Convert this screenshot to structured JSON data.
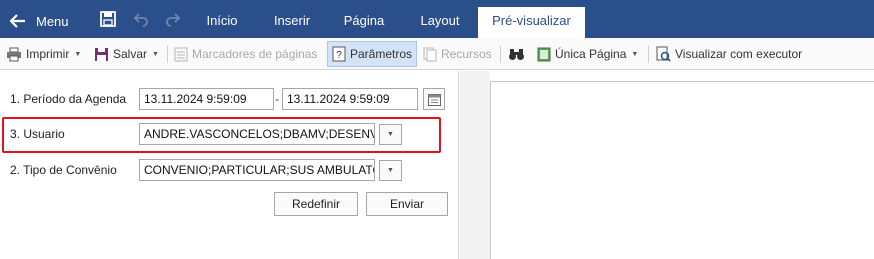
{
  "topbar": {
    "menu_label": "Menu",
    "tabs": [
      {
        "label": "Início"
      },
      {
        "label": "Inserir"
      },
      {
        "label": "Página"
      },
      {
        "label": "Layout"
      },
      {
        "label": "Pré-visualizar",
        "active": true
      }
    ]
  },
  "toolbar": {
    "print": "Imprimir",
    "save": "Salvar",
    "bookmarks": "Marcadores de páginas",
    "parameters": "Parâmetros",
    "resources": "Recursos",
    "single_page": "Única Página",
    "view_with_executor": "Visualizar com executor"
  },
  "params": {
    "agenda_label": "1. Período da Agenda",
    "agenda_start": "13.11.2024 9:59:09",
    "agenda_separator": "-",
    "agenda_end": "13.11.2024 9:59:09",
    "user_label": "3. Usuario",
    "user_value": "ANDRE.VASCONCELOS;DBAMV;DESENV",
    "insurance_label": "2. Tipo de Convênio",
    "insurance_value": "CONVENIO;PARTICULAR;SUS AMBULATO",
    "reset_button": "Redefinir",
    "submit_button": "Enviar"
  },
  "colors": {
    "ribbon": "#2a4f8a",
    "highlight": "#e0141c",
    "pressed": "#d2e3f8"
  },
  "icons": [
    "back-arrow-icon",
    "save-disk-icon",
    "undo-icon",
    "redo-icon",
    "printer-icon",
    "save-icon",
    "bookmarks-icon",
    "parameters-icon",
    "resources-icon",
    "binoculars-icon",
    "single-page-icon",
    "executor-icon",
    "calendar-icon",
    "dropdown-icon"
  ]
}
